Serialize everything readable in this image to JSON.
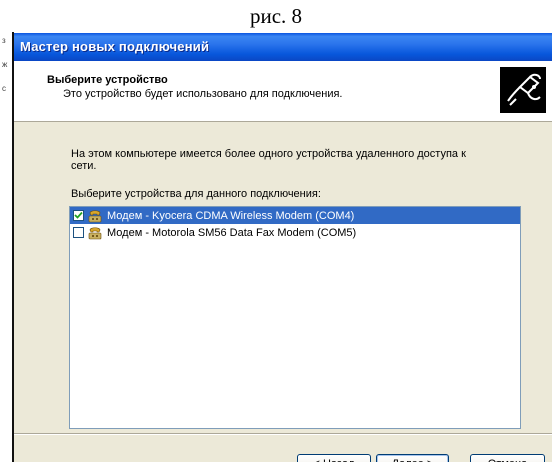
{
  "caption": "рис. 8",
  "window": {
    "title": "Мастер новых подключений"
  },
  "header": {
    "title": "Выберите устройство",
    "subtitle": "Это устройство будет использовано для подключения.",
    "icon": "telephone-cable-icon"
  },
  "body": {
    "message": "На этом компьютере имеется более одного устройства удаленного доступа к сети.",
    "prompt": "Выберите устройства для данного подключения:"
  },
  "devices": [
    {
      "label": "Модем - Kyocera CDMA Wireless Modem (COM4)",
      "checked": true,
      "selected": true
    },
    {
      "label": "Модем - Motorola SM56 Data Fax Modem (COM5)",
      "checked": false,
      "selected": false
    }
  ],
  "buttons": {
    "back": "< Назад",
    "next": "Далее >",
    "cancel": "Отмена"
  },
  "colors": {
    "titlebar": "#0a55e0",
    "selection": "#316ac5",
    "dialog_bg": "#ece9d8"
  }
}
